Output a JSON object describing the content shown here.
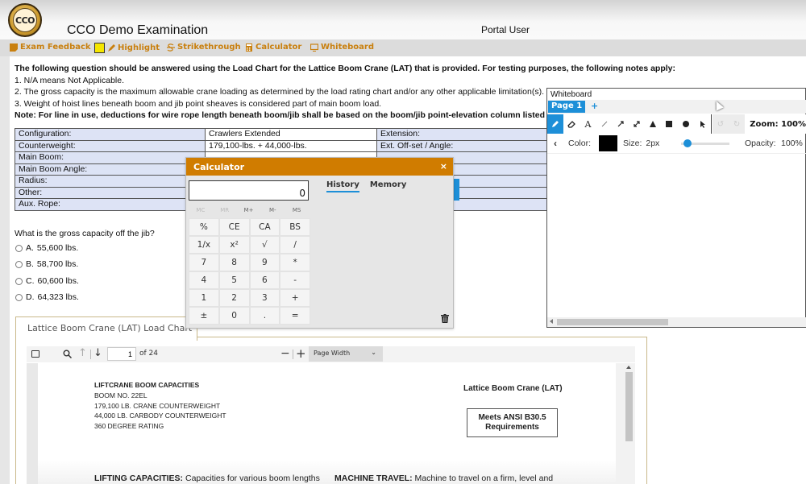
{
  "header": {
    "logo_text": "CCO",
    "title": "CCO Demo Examination",
    "user": "Portal User"
  },
  "toolbar": {
    "feedback": "Exam Feedback",
    "highlight": "Highlight",
    "strikethrough": "Strikethrough",
    "calculator": "Calculator",
    "whiteboard": "Whiteboard",
    "highlight_color": "#f5e600",
    "accent_color": "#c9800f"
  },
  "instructions": {
    "intro": "The following question should be answered using the Load Chart for the Lattice Boom Crane (LAT) that is provided.  For testing purposes, the following notes apply:",
    "notes": [
      "1. N/A means Not Applicable.",
      "2. The gross capacity is the maximum allowable crane loading as determined by the load rating chart and/or any other applicable limitation(s).",
      "3. Weight of hoist lines beneath boom and jib point sheaves is considered part of main boom load."
    ],
    "note_bold": "Note: For line in use, deductions for wire rope length beneath boom/jib shall be based on the boom/jib point-elevation column listed on the load chart."
  },
  "config_table": {
    "rows": [
      {
        "label": "Configuration:",
        "value": "Crawlers Extended",
        "label2": "Extension:",
        "value2": ""
      },
      {
        "label": "Counterweight:",
        "value": "179,100-lbs. + 44,000-lbs.",
        "label2": "Ext. Off-set / Angle:",
        "value2": ""
      },
      {
        "label": "Main Boom:",
        "value": "",
        "label2": "",
        "value2": ""
      },
      {
        "label": "Main Boom Angle:",
        "value": "",
        "label2": "",
        "value2": ""
      },
      {
        "label": "Radius:",
        "value": "",
        "label2": "",
        "value2": ""
      },
      {
        "label": "Other:",
        "value": "",
        "label2": "",
        "value2": ""
      },
      {
        "label": "Aux. Rope:",
        "value": "",
        "label2": "",
        "value2": ""
      }
    ]
  },
  "question": {
    "text": "What is the gross capacity off the jib?",
    "options": [
      {
        "letter": "A.",
        "text": "55,600 lbs."
      },
      {
        "letter": "B.",
        "text": "58,700 lbs."
      },
      {
        "letter": "C.",
        "text": "60,600 lbs."
      },
      {
        "letter": "D.",
        "text": "64,323 lbs."
      }
    ]
  },
  "load_chart": {
    "tab_label": "Lattice Boom Crane (LAT) Load Chart",
    "pdf": {
      "page_current": "1",
      "page_total": "of 24",
      "zoom_select": "Page Width"
    },
    "doc": {
      "heading_lines": [
        "LIFTCRANE BOOM CAPACITIES",
        "BOOM NO. 22EL",
        "179,100 LB. CRANE COUNTERWEIGHT",
        "44,000 LB. CARBODY COUNTERWEIGHT",
        "360 DEGREE RATING"
      ],
      "crane_title": "Lattice Boom Crane (LAT)",
      "ansi_line1": "Meets ANSI B30.5",
      "ansi_line2": "Requirements",
      "lifting_bold": "LIFTING CAPACITIES:",
      "lifting_text": " Capacities for various boom lengths",
      "travel_bold": "MACHINE TRAVEL:",
      "travel_text": " Machine to travel on a firm, level and"
    }
  },
  "calculator": {
    "title": "Calculator",
    "close": "×",
    "display": "0",
    "memory_keys": [
      "MC",
      "MR",
      "M+",
      "M-",
      "MS"
    ],
    "keys": [
      "%",
      "CE",
      "CA",
      "BS",
      "1/x",
      "x²",
      "√",
      "/",
      "7",
      "8",
      "9",
      "*",
      "4",
      "5",
      "6",
      "-",
      "1",
      "2",
      "3",
      "+",
      "±",
      "0",
      ".",
      "="
    ],
    "tabs": [
      "History",
      "Memory"
    ],
    "header_color": "#d07c00"
  },
  "whiteboard": {
    "title": "Whiteboard",
    "page": "Page 1",
    "add_page": "+",
    "zoom": "Zoom: 100%",
    "color_label": "Color:",
    "color_value": "#000000",
    "size_label": "Size:",
    "size_value": "2px",
    "opacity_label": "Opacity:",
    "opacity_value": "100%",
    "size_slider_fraction": 0.05
  }
}
